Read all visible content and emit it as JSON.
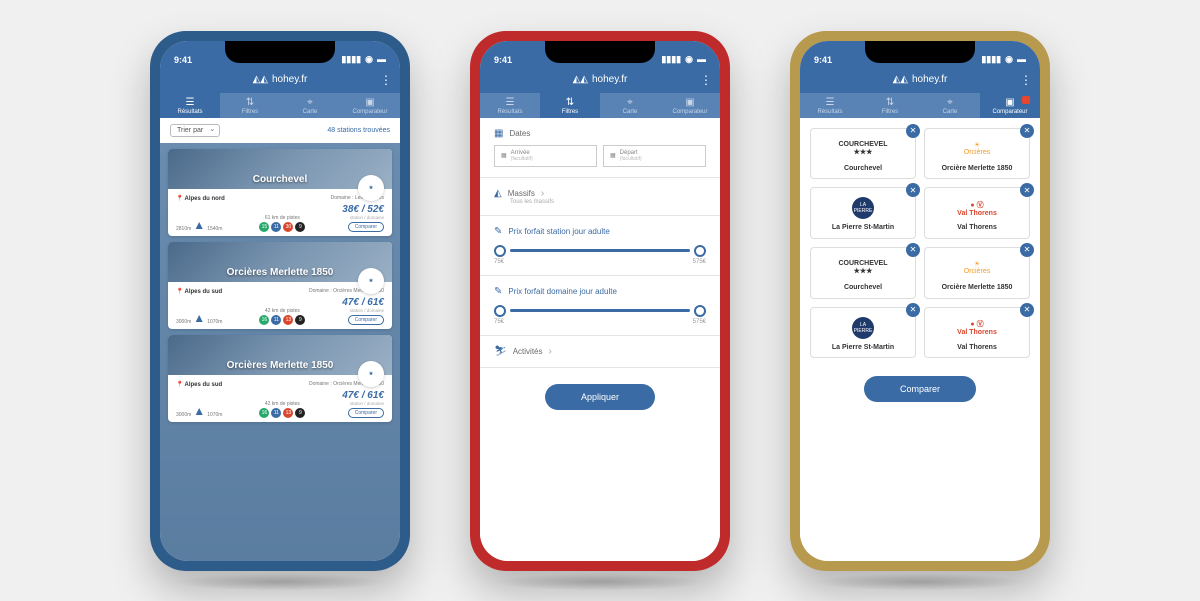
{
  "status": {
    "time": "9:41"
  },
  "header": {
    "title": "hohey.fr"
  },
  "tabs": [
    "Résultats",
    "Filtres",
    "Carte",
    "Comparateur"
  ],
  "phone1": {
    "sort": "Trier par",
    "count": "48 stations trouvées",
    "cards": [
      {
        "name": "Courchevel",
        "region": "Alpes du nord",
        "domain": "Domaine : Les 3 vallées",
        "alt_hi": "2810m",
        "alt_lo": "1540m",
        "pistes": "61 km de pistes",
        "pills": [
          "15",
          "11",
          "30",
          "9"
        ],
        "price": "38€ / 52€",
        "price_sub": "station / domaine",
        "compare": "Comparer"
      },
      {
        "name": "Orcières Merlette 1850",
        "region": "Alpes du sud",
        "domain": "Domaine : Orcières Merlette 1850",
        "alt_hi": "3000m",
        "alt_lo": "1070m",
        "pistes": "42 km de pistes",
        "pills": [
          "16",
          "11",
          "13",
          "9"
        ],
        "price": "47€ / 61€",
        "price_sub": "station / domaine",
        "compare": "Comparer"
      },
      {
        "name": "Orcières Merlette 1850",
        "region": "Alpes du sud",
        "domain": "Domaine : Orcières Merlette 1850",
        "alt_hi": "3000m",
        "alt_lo": "1070m",
        "pistes": "42 km de pistes",
        "pills": [
          "16",
          "11",
          "13",
          "9"
        ],
        "price": "47€ / 61€",
        "price_sub": "station / domaine",
        "compare": "Comparer"
      }
    ]
  },
  "phone2": {
    "dates_label": "Dates",
    "arrive": "Arrivée",
    "depart": "Départ",
    "facultatif": "(facultatif)",
    "massifs": "Massifs",
    "massifs_sub": "Tous les massifs",
    "slider1": "Prix forfait station jour adulte",
    "slider2": "Prix forfait domaine jour adulte",
    "slider_min": "75€",
    "slider_max": "575€",
    "activites": "Activités",
    "apply": "Appliquer"
  },
  "phone3": {
    "items": [
      {
        "name": "Courchevel",
        "logo": "courchevel"
      },
      {
        "name": "Orcière Merlette 1850",
        "logo": "orcieres"
      },
      {
        "name": "La Pierre St-Martin",
        "logo": "pierre"
      },
      {
        "name": "Val Thorens",
        "logo": "valthorens"
      },
      {
        "name": "Courchevel",
        "logo": "courchevel"
      },
      {
        "name": "Orcière Merlette 1850",
        "logo": "orcieres"
      },
      {
        "name": "La Pierre St-Martin",
        "logo": "pierre"
      },
      {
        "name": "Val Thorens",
        "logo": "valthorens"
      }
    ],
    "compare": "Comparer"
  }
}
